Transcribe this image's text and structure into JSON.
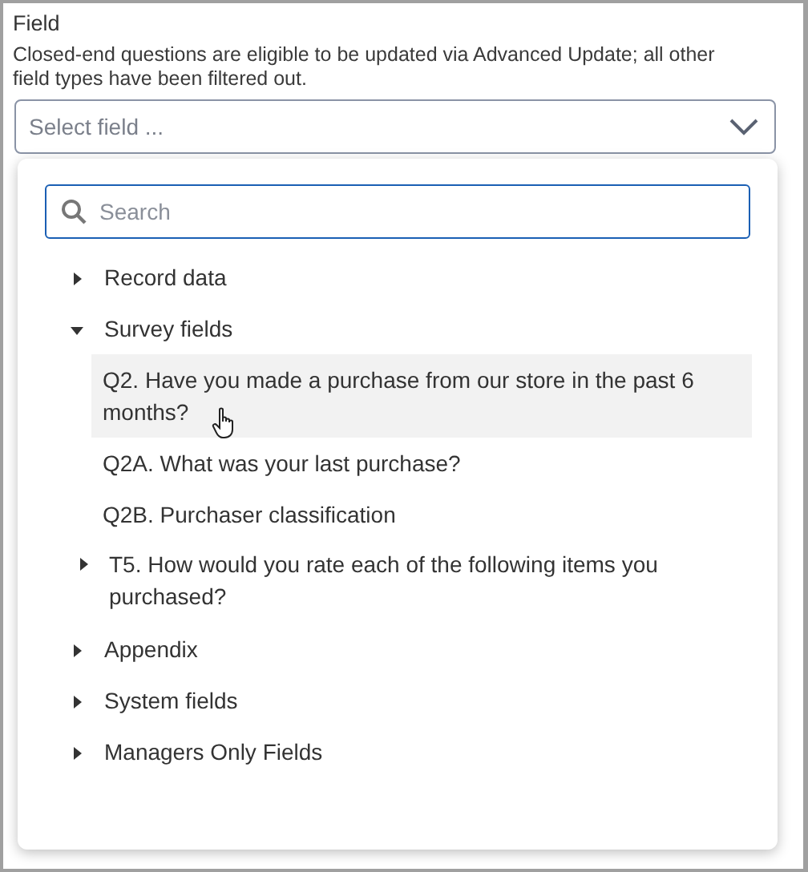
{
  "field": {
    "label": "Field",
    "help": "Closed-end questions are eligible to be updated via Advanced Update; all other field types have been filtered out.",
    "select": {
      "placeholder": "Select field ..."
    }
  },
  "dropdown": {
    "search": {
      "placeholder": "Search"
    },
    "tree": [
      {
        "kind": "group",
        "label": "Record data",
        "expanded": false
      },
      {
        "kind": "group",
        "label": "Survey fields",
        "expanded": true,
        "children": [
          {
            "kind": "field",
            "label": "Q2. Have you made a purchase from our store in the past 6 months?",
            "highlighted": true
          },
          {
            "kind": "field",
            "label": "Q2A. What was your last purchase?",
            "highlighted": false
          },
          {
            "kind": "field",
            "label": "Q2B. Purchaser classification",
            "highlighted": false
          },
          {
            "kind": "group",
            "label": "T5. How would you rate each of the following items you purchased?",
            "expanded": false
          }
        ]
      },
      {
        "kind": "group",
        "label": "Appendix",
        "expanded": false
      },
      {
        "kind": "group",
        "label": "System fields",
        "expanded": false
      },
      {
        "kind": "group",
        "label": "Managers Only Fields",
        "expanded": false
      }
    ]
  }
}
